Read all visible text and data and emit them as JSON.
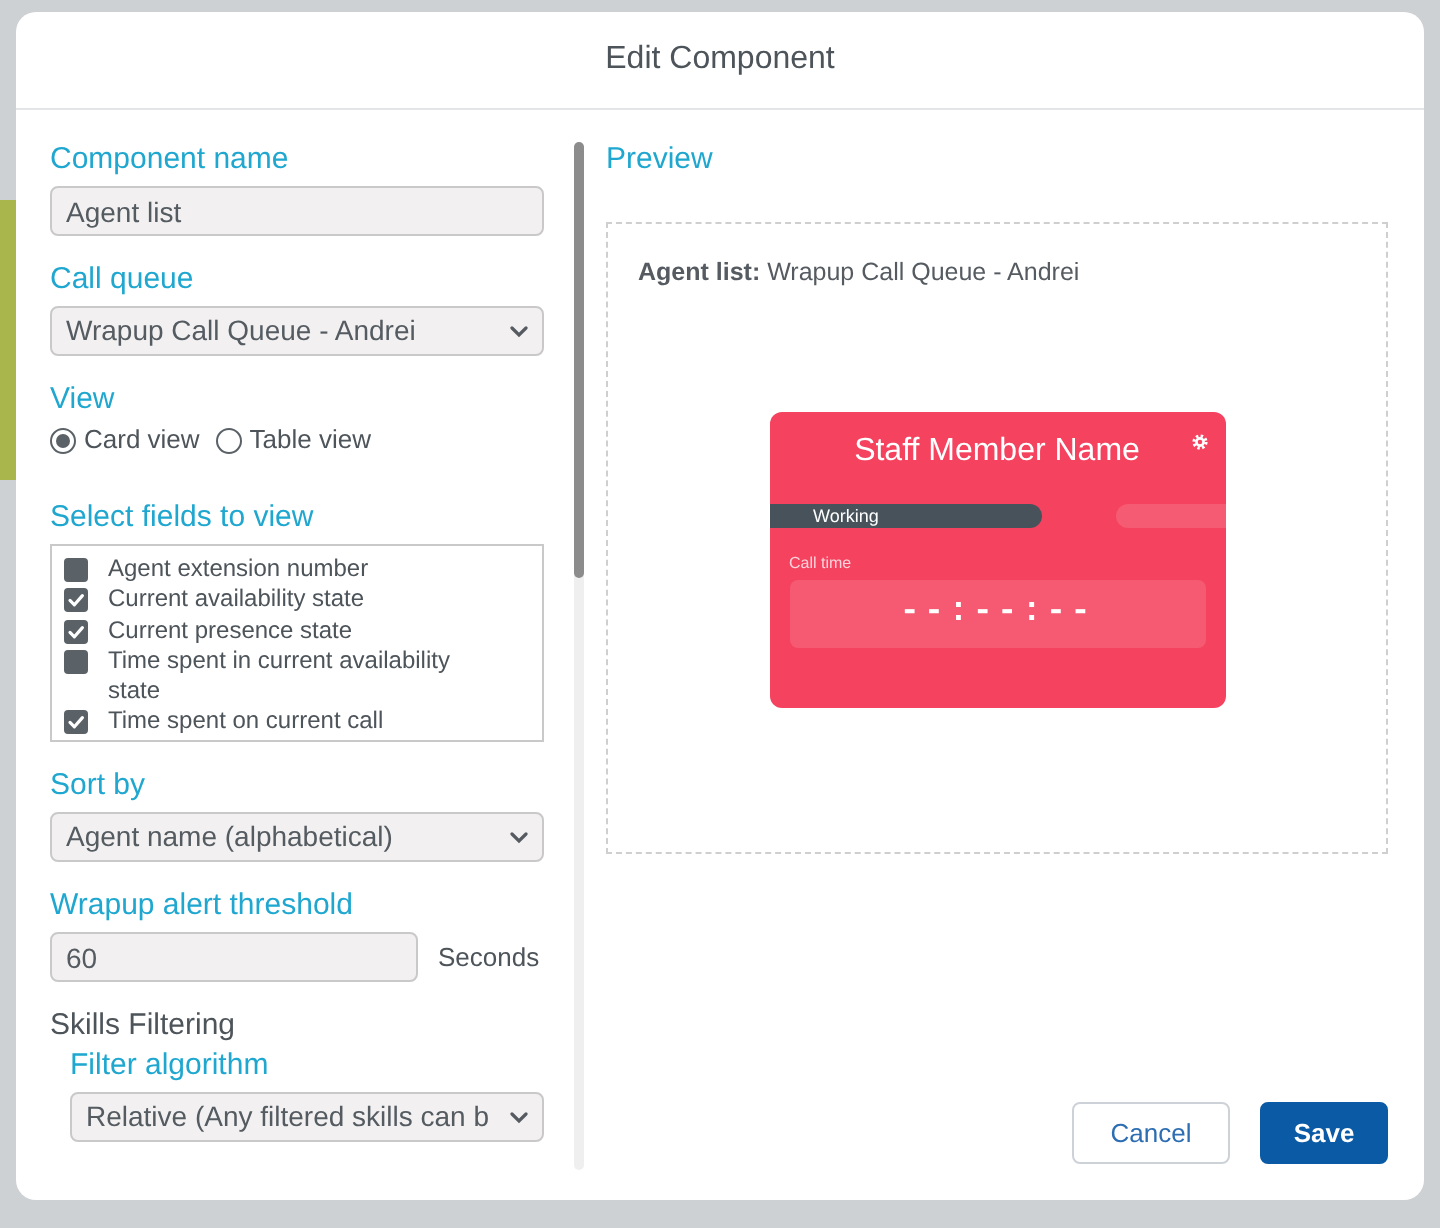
{
  "dialog": {
    "title": "Edit Component"
  },
  "form": [
    {
      "kind": "text",
      "label": "Component name",
      "value": "Agent list"
    },
    {
      "kind": "select",
      "label": "Call queue",
      "value": "Wrapup Call Queue - Andrei"
    },
    {
      "kind": "radio",
      "label": "View",
      "options": [
        {
          "label": "Card view",
          "selected": true
        },
        {
          "label": "Table view",
          "selected": false
        }
      ]
    },
    {
      "kind": "checklist",
      "label": "Select fields to view",
      "items": [
        {
          "label": "Agent extension number",
          "checked": false
        },
        {
          "label": "Current availability state",
          "checked": true
        },
        {
          "label": "Current presence state",
          "checked": true
        },
        {
          "label": "Time spent in current availability state",
          "checked": false
        },
        {
          "label": "Time spent on current call",
          "checked": true
        }
      ]
    },
    {
      "kind": "select",
      "label": "Sort by",
      "value": "Agent name (alphabetical)"
    },
    {
      "kind": "number",
      "label": "Wrapup alert threshold",
      "value": "60",
      "unit": "Seconds"
    },
    {
      "kind": "section",
      "label": "Skills Filtering",
      "children": [
        {
          "kind": "select",
          "label": "Filter algorithm",
          "value": "Relative (Any filtered skills can b"
        }
      ]
    }
  ],
  "preview": {
    "label": "Preview",
    "caption": "**Agent list:** Wrapup Call Queue - Andrei",
    "card": {
      "name": "Staff Member Name",
      "status": "Working",
      "timer_label": "Call time",
      "timer": "--:--:--"
    }
  },
  "buttons": [
    {
      "label": "Cancel",
      "kind": "secondary"
    },
    {
      "label": "Save",
      "kind": "primary"
    }
  ]
}
